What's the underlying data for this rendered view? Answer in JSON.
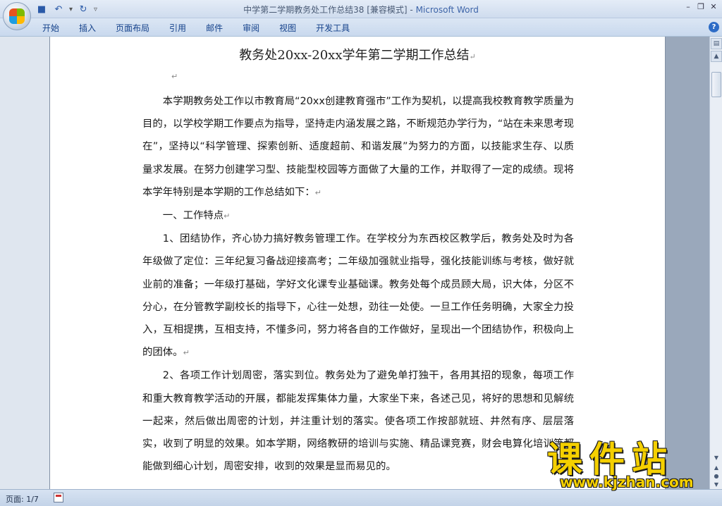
{
  "window": {
    "title_doc": "中学第二学期教务处工作总结38 [兼容模式]",
    "title_sep": " - ",
    "title_app": "Microsoft Word"
  },
  "ribbon": {
    "tabs": [
      "开始",
      "插入",
      "页面布局",
      "引用",
      "邮件",
      "审阅",
      "视图",
      "开发工具"
    ]
  },
  "document": {
    "title": "教务处20xx-20xx学年第二学期工作总结",
    "paragraphs": [
      "本学期教务处工作以市教育局“20xx创建教育强市”工作为契机，以提高我校教育教学质量为目的，以学校学期工作要点为指导，坚持走内涵发展之路，不断规范办学行为，“站在未来思考现在”，坚持以“科学管理、探索创新、适度超前、和谐发展”为努力的方面，以技能求生存、以质量求发展。在努力创建学习型、技能型校园等方面做了大量的工作，并取得了一定的成绩。现将本学年特别是本学期的工作总结如下：",
      "一、工作特点",
      "1、团结协作，齐心协力搞好教务管理工作。在学校分为东西校区教学后，教务处及时为各年级做了定位：三年纪复习备战迎接高考；二年级加强就业指导，强化技能训练与考核，做好就业前的准备；一年级打基础，学好文化课专业基础课。教务处每个成员顾大局，识大体，分区不分心，在分管教学副校长的指导下，心往一处想，劲往一处使。一旦工作任务明确，大家全力投入，互相提携，互相支持，不懂多问，努力将各自的工作做好，呈现出一个团结协作，积极向上的团体。",
      "2、各项工作计划周密，落实到位。教务处为了避免单打独干，各用其招的现象，每项工作和重大教育教学活动的开展，都能发挥集体力量，大家坐下来，各述己见，将好的思想和见解统一起来，然后做出周密的计划，并注重计划的落实。使各项工作按部就班、井然有序、层层落实，收到了明显的效果。如本学期，网络教研的培训与实施、精品课竞赛，财会电算化培训等都能做到细心计划，周密安排，收到的效果是显而易见的。"
    ]
  },
  "status": {
    "page": "页面: 1/7"
  },
  "watermark": {
    "cn": "课件站",
    "url": "www.kjzhan.com"
  }
}
